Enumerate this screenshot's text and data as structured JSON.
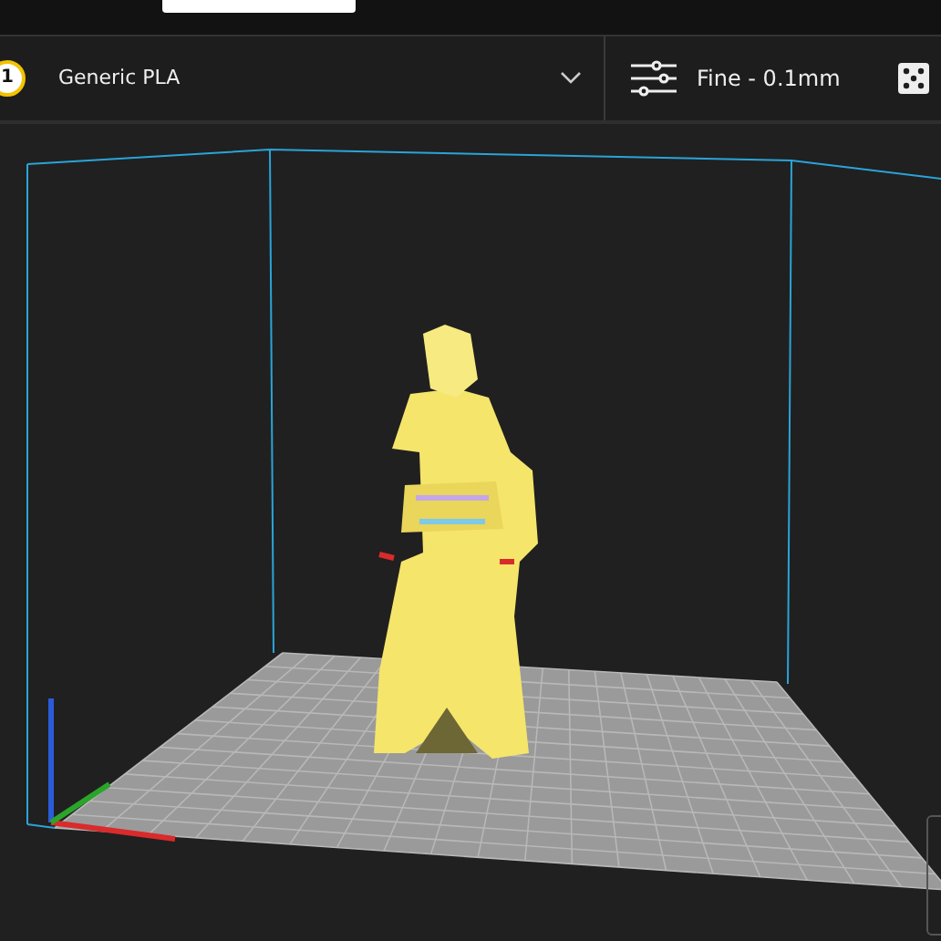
{
  "extruder": {
    "number": "1",
    "material": "Generic PLA"
  },
  "print_settings": {
    "profile": "Fine - 0.1mm"
  }
}
